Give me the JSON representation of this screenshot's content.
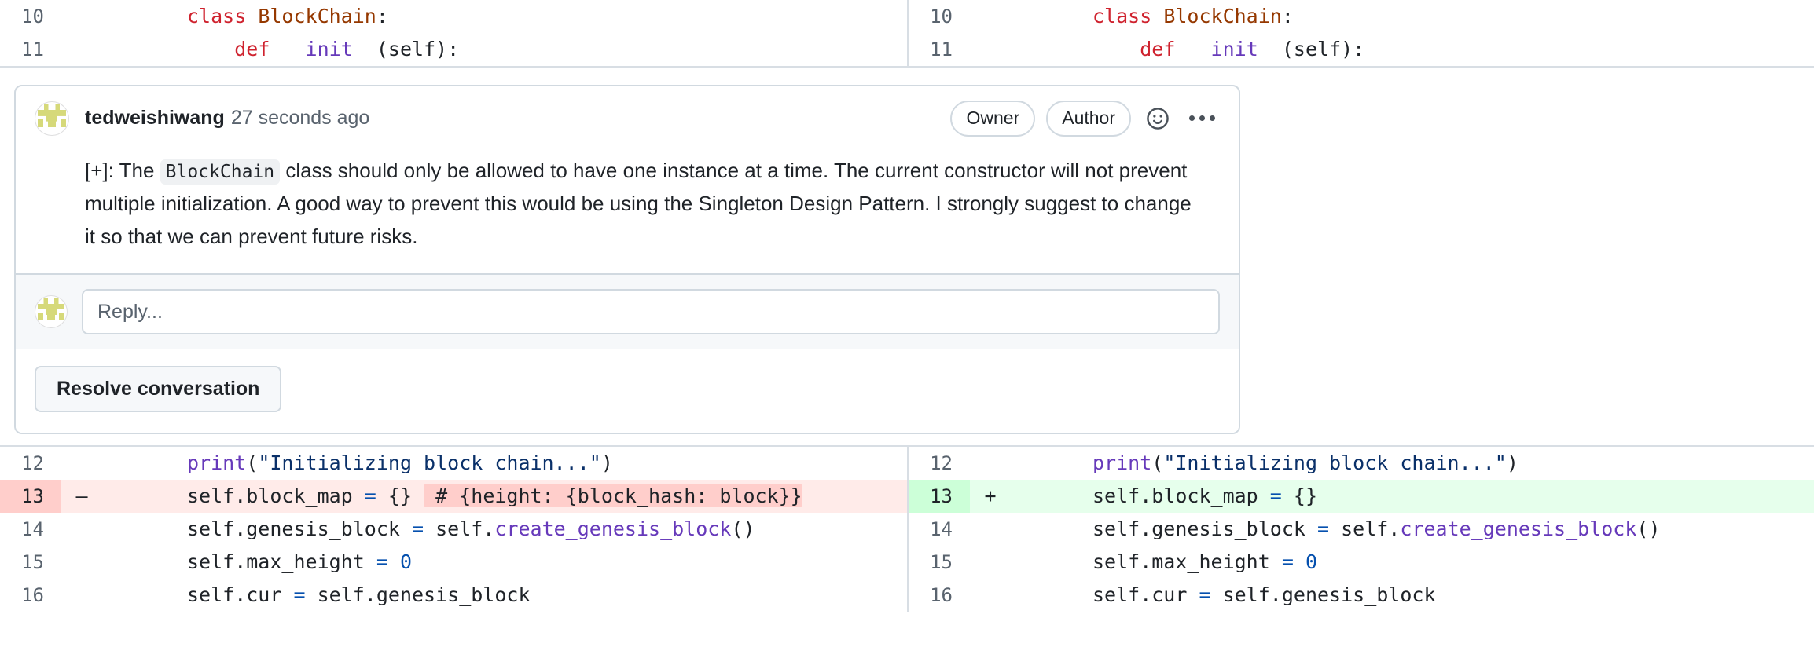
{
  "diff": {
    "top_rows_left": [
      {
        "line": "10",
        "marker": "",
        "type": "context",
        "tokens": [
          {
            "t": "class ",
            "c": "k"
          },
          {
            "t": "BlockChain",
            "c": "cls"
          },
          {
            "t": ":",
            "c": "pct"
          }
        ]
      },
      {
        "line": "11",
        "marker": "",
        "type": "context",
        "tokens": [
          {
            "t": "    ",
            "c": "pct"
          },
          {
            "t": "def ",
            "c": "k"
          },
          {
            "t": "__init__",
            "c": "fn"
          },
          {
            "t": "(self):",
            "c": "pct"
          }
        ]
      }
    ],
    "top_rows_right": [
      {
        "line": "10",
        "marker": "",
        "type": "context",
        "tokens": [
          {
            "t": "class ",
            "c": "k"
          },
          {
            "t": "BlockChain",
            "c": "cls"
          },
          {
            "t": ":",
            "c": "pct"
          }
        ]
      },
      {
        "line": "11",
        "marker": "",
        "type": "context",
        "tokens": [
          {
            "t": "    ",
            "c": "pct"
          },
          {
            "t": "def ",
            "c": "k"
          },
          {
            "t": "__init__",
            "c": "fn"
          },
          {
            "t": "(self):",
            "c": "pct"
          }
        ]
      }
    ],
    "bottom_rows_left": [
      {
        "line": "12",
        "marker": "",
        "type": "context",
        "tokens": [
          {
            "t": "print",
            "c": "fn"
          },
          {
            "t": "(",
            "c": "pct"
          },
          {
            "t": "\"Initializing block chain...\"",
            "c": "str"
          },
          {
            "t": ")",
            "c": "pct"
          }
        ]
      },
      {
        "line": "13",
        "marker": "–",
        "type": "del",
        "tokens": [
          {
            "t": "self.block_map ",
            "c": "pct"
          },
          {
            "t": "=",
            "c": "op"
          },
          {
            "t": " {} ",
            "c": "pct"
          },
          {
            "t": " # {height: {block_hash: block}}",
            "c": "hl-del"
          }
        ]
      },
      {
        "line": "14",
        "marker": "",
        "type": "context",
        "tokens": [
          {
            "t": "self.genesis_block ",
            "c": "pct"
          },
          {
            "t": "=",
            "c": "op"
          },
          {
            "t": " self.",
            "c": "pct"
          },
          {
            "t": "create_genesis_block",
            "c": "fn"
          },
          {
            "t": "()",
            "c": "pct"
          }
        ]
      },
      {
        "line": "15",
        "marker": "",
        "type": "context",
        "tokens": [
          {
            "t": "self.max_height ",
            "c": "pct"
          },
          {
            "t": "=",
            "c": "op"
          },
          {
            "t": " ",
            "c": "pct"
          },
          {
            "t": "0",
            "c": "num"
          }
        ]
      },
      {
        "line": "16",
        "marker": "",
        "type": "context",
        "tokens": [
          {
            "t": "self.cur ",
            "c": "pct"
          },
          {
            "t": "=",
            "c": "op"
          },
          {
            "t": " self.genesis_block",
            "c": "pct"
          }
        ]
      }
    ],
    "bottom_rows_right": [
      {
        "line": "12",
        "marker": "",
        "type": "context",
        "tokens": [
          {
            "t": "print",
            "c": "fn"
          },
          {
            "t": "(",
            "c": "pct"
          },
          {
            "t": "\"Initializing block chain...\"",
            "c": "str"
          },
          {
            "t": ")",
            "c": "pct"
          }
        ]
      },
      {
        "line": "13",
        "marker": "+",
        "type": "add",
        "tokens": [
          {
            "t": "self.block_map ",
            "c": "pct"
          },
          {
            "t": "=",
            "c": "op"
          },
          {
            "t": " {}",
            "c": "pct"
          }
        ]
      },
      {
        "line": "14",
        "marker": "",
        "type": "context",
        "tokens": [
          {
            "t": "self.genesis_block ",
            "c": "pct"
          },
          {
            "t": "=",
            "c": "op"
          },
          {
            "t": " self.",
            "c": "pct"
          },
          {
            "t": "create_genesis_block",
            "c": "fn"
          },
          {
            "t": "()",
            "c": "pct"
          }
        ]
      },
      {
        "line": "15",
        "marker": "",
        "type": "context",
        "tokens": [
          {
            "t": "self.max_height ",
            "c": "pct"
          },
          {
            "t": "=",
            "c": "op"
          },
          {
            "t": " ",
            "c": "pct"
          },
          {
            "t": "0",
            "c": "num"
          }
        ]
      },
      {
        "line": "16",
        "marker": "",
        "type": "context",
        "tokens": [
          {
            "t": "self.cur ",
            "c": "pct"
          },
          {
            "t": "=",
            "c": "op"
          },
          {
            "t": " self.genesis_block",
            "c": "pct"
          }
        ]
      }
    ]
  },
  "comment": {
    "author": "tedweishiwang",
    "timestamp": "27 seconds ago",
    "badges": [
      "Owner",
      "Author"
    ],
    "reaction_icon": "smiley-icon",
    "more_icon": "kebab-menu-icon",
    "body": {
      "prefix": "[+]: The ",
      "code": "BlockChain",
      "suffix": " class should only be allowed to have one instance at a time. The current constructor will not prevent multiple initialization. A good way to prevent this would be using the Singleton Design Pattern. I strongly suggest to change it so that we can prevent future risks."
    },
    "reply_placeholder": "Reply...",
    "resolve_label": "Resolve conversation"
  },
  "colors": {
    "add_bg": "#e6ffec",
    "add_gutter": "#ccffd8",
    "del_bg": "#ffebe9",
    "del_gutter": "#ffcecb",
    "del_highlight": "#ffcecb",
    "border": "#d1d9e0",
    "muted_text": "#59636e",
    "keyword": "#cf222e",
    "class_name": "#953800",
    "function": "#6639ba",
    "string": "#0a3069",
    "operator": "#0550ae"
  }
}
